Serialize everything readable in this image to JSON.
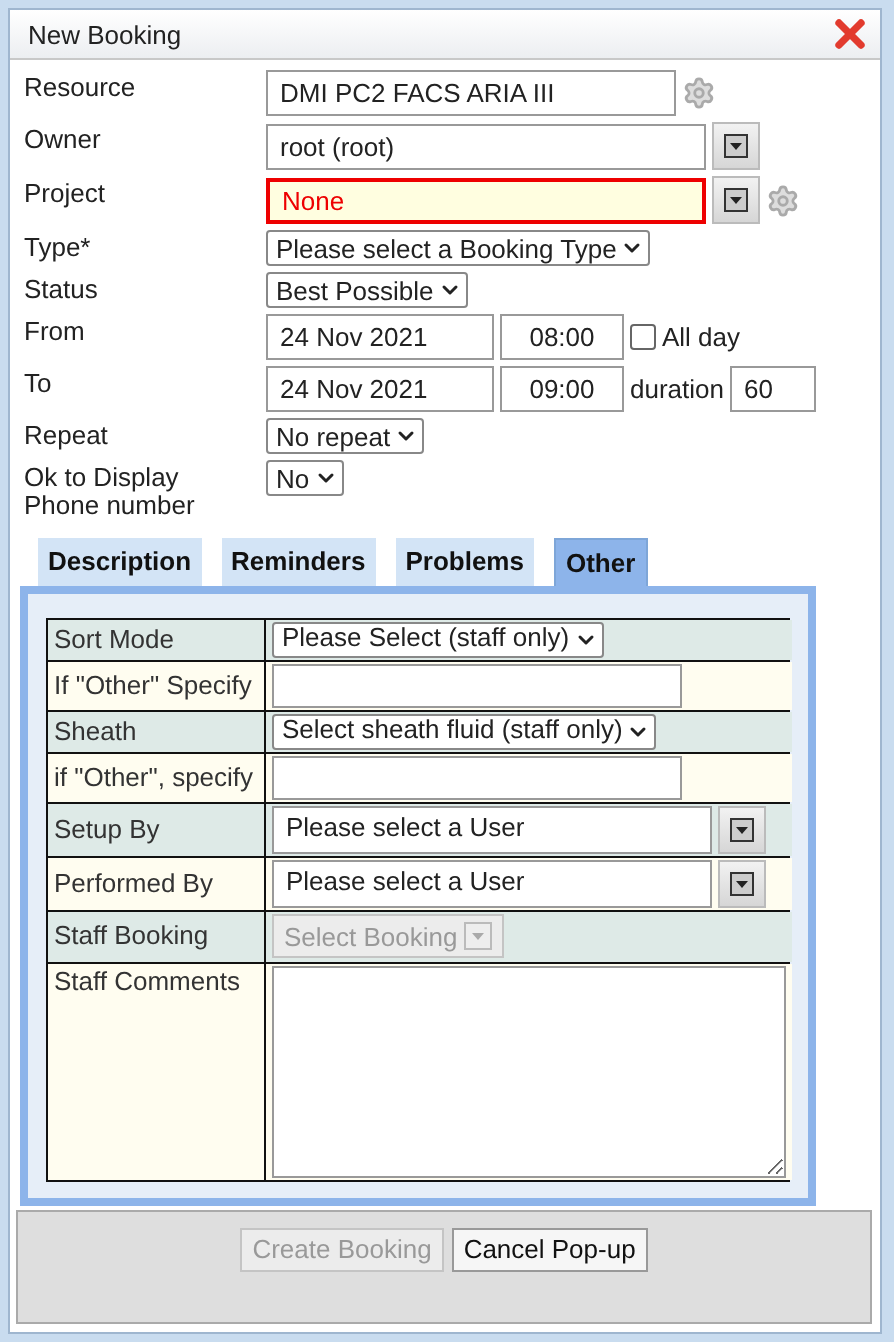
{
  "window": {
    "title": "New Booking"
  },
  "fields": [
    {
      "label": "Resource",
      "kind": "text",
      "value": "DMI PC2 FACS ARIA III",
      "gear": true
    },
    {
      "label": "Owner",
      "kind": "lookup",
      "value": "root (root)",
      "invalid": false,
      "gear": false
    },
    {
      "label": "Project",
      "kind": "lookup",
      "value": "None",
      "invalid": true,
      "gear": true
    },
    {
      "label": "Type*",
      "kind": "select",
      "value": "Please select a Booking Type"
    },
    {
      "label": "Status",
      "kind": "select",
      "value": "Best Possible"
    },
    {
      "label": "From",
      "kind": "datetime",
      "date": "24 Nov 2021",
      "time": "08:00",
      "all_day": {
        "label": "All day",
        "checked": false
      }
    },
    {
      "label": "To",
      "kind": "datetime",
      "date": "24 Nov 2021",
      "time": "09:00",
      "duration": {
        "label": "duration",
        "value": "60"
      }
    },
    {
      "label": "Repeat",
      "kind": "select",
      "value": "No repeat"
    },
    {
      "label": "Ok to Display Phone number",
      "kind": "select",
      "value": "No"
    }
  ],
  "tabs": [
    {
      "label": "Description",
      "selected": false
    },
    {
      "label": "Reminders",
      "selected": false
    },
    {
      "label": "Problems",
      "selected": false
    },
    {
      "label": "Other",
      "selected": true
    }
  ],
  "other_table": [
    {
      "label": "Sort Mode",
      "kind": "select",
      "value": "Please Select (staff only)"
    },
    {
      "label": "If \"Other\" Specify",
      "kind": "text"
    },
    {
      "label": "Sheath",
      "kind": "select",
      "value": "Select sheath fluid (staff only)"
    },
    {
      "label": "if \"Other\", specify",
      "kind": "text"
    },
    {
      "label": "Setup By",
      "kind": "lookup",
      "value": "Please select a User"
    },
    {
      "label": "Performed By",
      "kind": "lookup",
      "value": "Please select a User"
    },
    {
      "label": "Staff Booking",
      "kind": "button",
      "value": "Select Booking",
      "disabled": true
    },
    {
      "label": "Staff Comments",
      "kind": "textarea"
    }
  ],
  "buttons": [
    {
      "label": "Create Booking",
      "disabled": true
    },
    {
      "label": "Cancel Pop-up",
      "disabled": false
    }
  ]
}
